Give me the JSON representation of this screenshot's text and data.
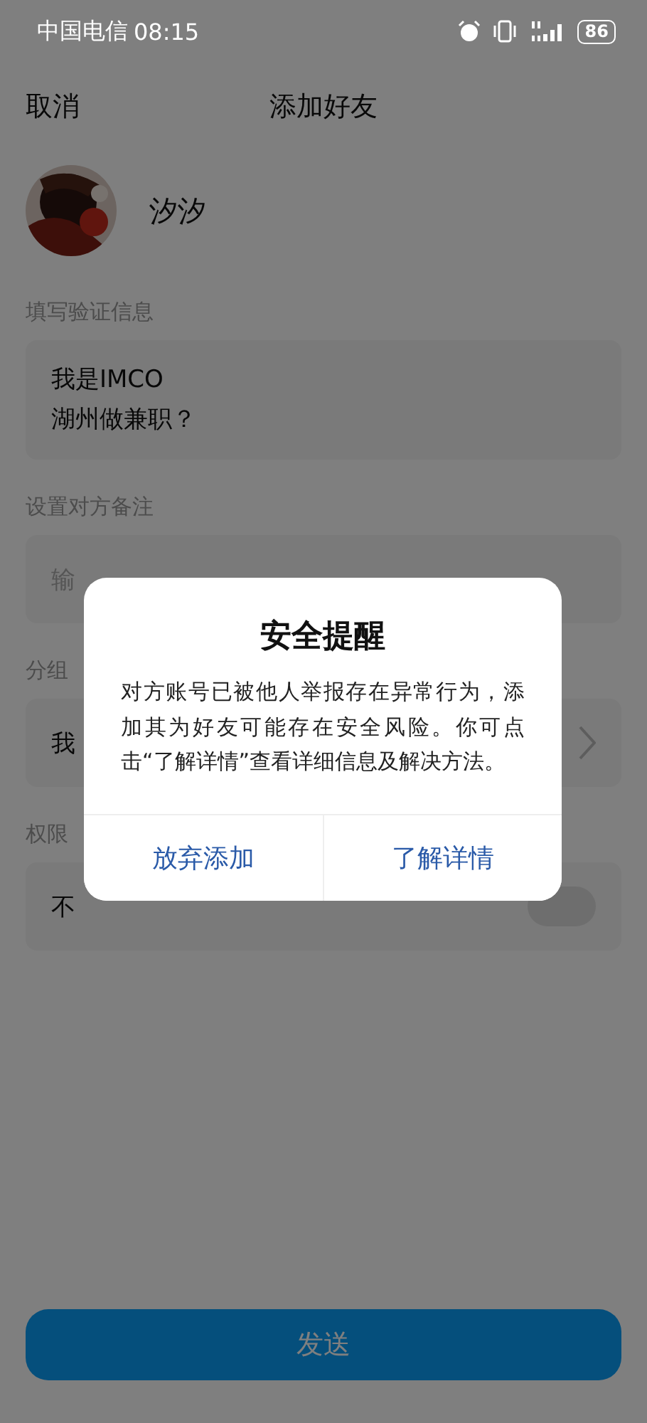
{
  "status_bar": {
    "carrier": "中国电信",
    "time": "08:15",
    "battery": "86"
  },
  "nav": {
    "cancel": "取消",
    "title": "添加好友"
  },
  "contact": {
    "name": "汐汐"
  },
  "sections": [
    {
      "label": "填写验证信息",
      "kind": "textarea",
      "value": "我是IMCO\n湖州做兼职？"
    },
    {
      "label": "设置对方备注",
      "kind": "input",
      "placeholder": "输"
    },
    {
      "label": "分组",
      "kind": "select",
      "value": "我"
    },
    {
      "label": "权限",
      "kind": "toggle",
      "value": "不",
      "on": false
    }
  ],
  "send_button": "发送",
  "dialog": {
    "title": "安全提醒",
    "message": "对方账号已被他人举报存在异常行为，添加其为好友可能存在安全风险。你可点击“了解详情”查看详细信息及解决方法。",
    "buttons": [
      {
        "label": "放弃添加"
      },
      {
        "label": "了解详情"
      }
    ]
  }
}
